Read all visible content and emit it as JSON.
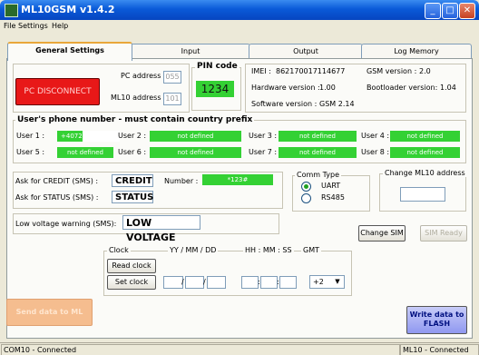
{
  "window": {
    "title": "ML10GSM v1.4.2"
  },
  "menu": {
    "items": [
      "File",
      "Settings",
      "Help"
    ]
  },
  "tabs": [
    "General Settings",
    "Input",
    "Output",
    "Log Memory"
  ],
  "connection": {
    "button_label": "PC DISCONNECT",
    "pc_address_label": "PC address :",
    "pc_address_value": "055",
    "ml10_address_label": "ML10 address :",
    "ml10_address_value": "101",
    "pin_label": "PIN code",
    "pin_value": "1234"
  },
  "device_info": {
    "imei_label": "IMEI :",
    "imei_value": "862170017114677",
    "gsm_version_label": "GSM version :",
    "gsm_version_value": "2.0",
    "hardware_label": "Hardware version :",
    "hardware_value": "1.00",
    "bootloader_label": "Bootloader version:",
    "bootloader_value": "1.04",
    "software_label": "Software version :",
    "software_value": "GSM 2.14"
  },
  "users": {
    "title": "User's phone number  -  must contain country prefix",
    "items": [
      {
        "label": "User 1 :",
        "value": "+4072"
      },
      {
        "label": "User 2 :",
        "value": "not defined"
      },
      {
        "label": "User 3 :",
        "value": "not defined"
      },
      {
        "label": "User 4 :",
        "value": "not defined"
      },
      {
        "label": "User 5 :",
        "value": "not defined"
      },
      {
        "label": "User 6 :",
        "value": "not defined"
      },
      {
        "label": "User 7 :",
        "value": "not defined"
      },
      {
        "label": "User 8 :",
        "value": "not defined"
      }
    ]
  },
  "sms": {
    "credit_label": "Ask for CREDIT (SMS) :",
    "credit_value": "CREDIT",
    "number_label": "Number :",
    "number_value": "*123#",
    "status_label": "Ask for STATUS (SMS) :",
    "status_value": "STATUS",
    "low_voltage_label": "Low voltage warning (SMS):",
    "low_voltage_value": "LOW VOLTAGE"
  },
  "comm": {
    "title": "Comm Type",
    "options": [
      "UART",
      "RS485"
    ],
    "selected": "UART",
    "change_address_title": "Change ML10 address",
    "change_address_value": ""
  },
  "sim": {
    "change_label": "Change SIM",
    "ready_label": "SIM Ready"
  },
  "clock": {
    "title": "Clock",
    "date_header": "YY / MM / DD",
    "time_header": "HH : MM : SS",
    "gmt_header": "GMT",
    "date_sep": "/",
    "time_sep": ":",
    "read_label": "Read clock",
    "set_label": "Set clock",
    "gmt_value": "+2",
    "dropdown_arrow": "▼"
  },
  "actions": {
    "send_label": "Send data to ML",
    "write_label": "Write data to FLASH"
  },
  "status": {
    "left": "COM10 - Connected",
    "right": "ML10 - Connected"
  },
  "colors": {
    "accent_green": "#34d134",
    "disconnect_red": "#e81818",
    "tab_highlight": "#e9a73a"
  }
}
